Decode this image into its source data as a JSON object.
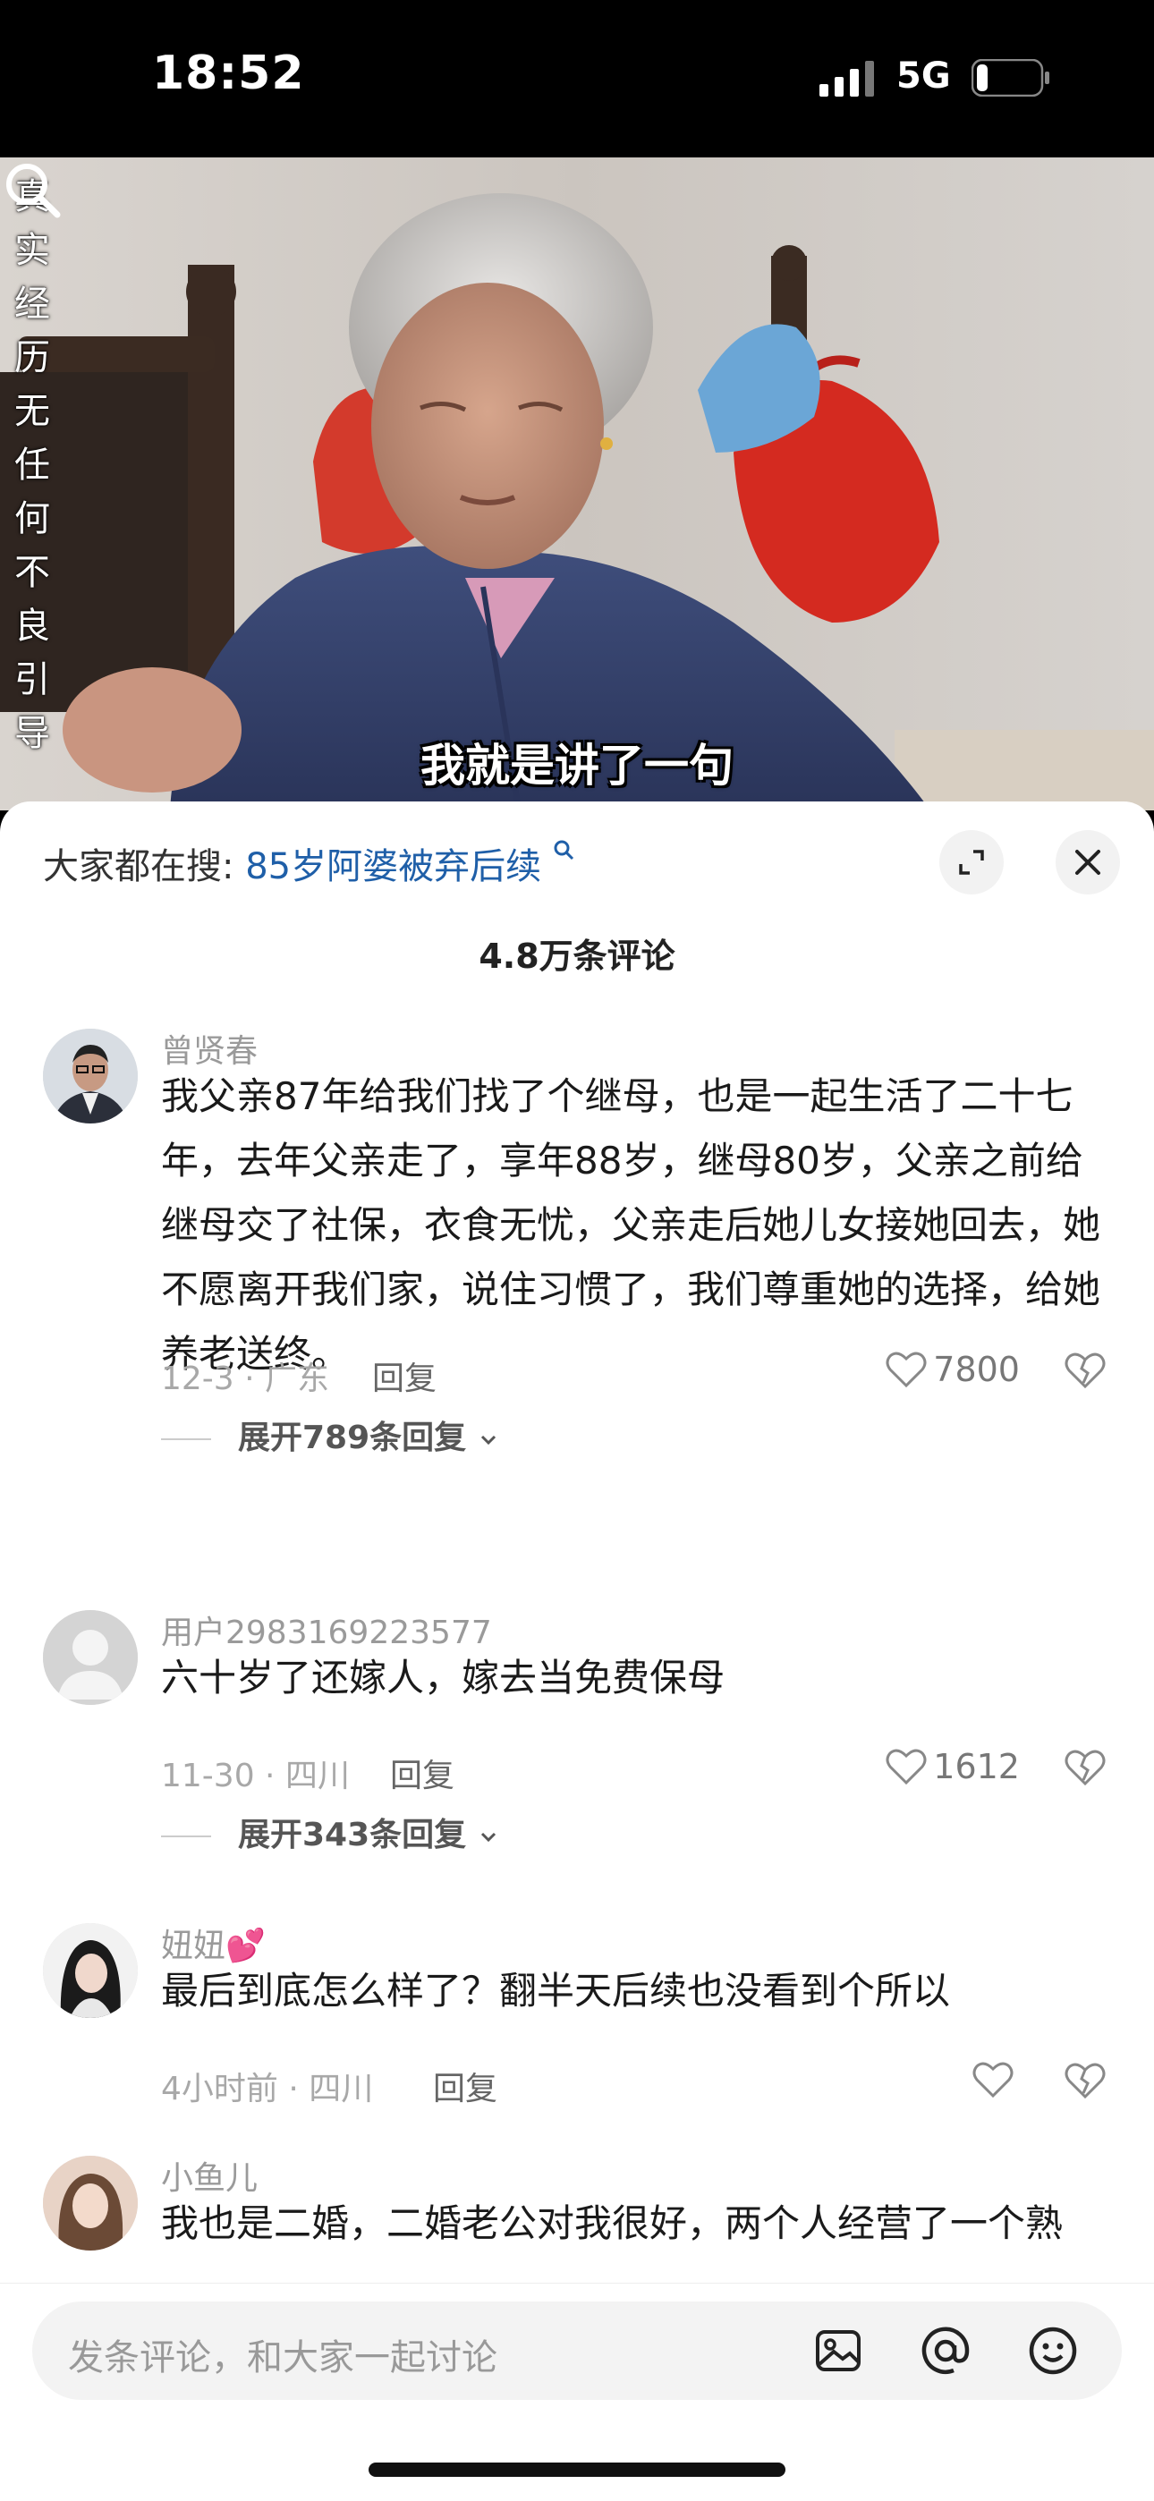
{
  "status": {
    "time": "18:52",
    "network": "5G"
  },
  "video": {
    "vertical_caption": [
      "真",
      "实",
      "经",
      "历",
      "无",
      "任",
      "何",
      "不",
      "良",
      "引",
      "导"
    ],
    "subtitle": "我就是讲了一句"
  },
  "comments_panel": {
    "search_prefix": "大家都在搜:",
    "search_term": "85岁阿婆被弃后续",
    "count_label": "4.8万条评论"
  },
  "comments": [
    {
      "username": "曾贤春",
      "text": "我父亲87年给我们找了个继母，也是一起生活了二十七年，去年父亲走了，享年88岁，继母80岁，父亲之前给继母交了社保，衣食无忧，父亲走后她儿女接她回去，她不愿离开我们家，说住习惯了，我们尊重她的选择，给她养老送终。",
      "meta": "12-3 · 广东",
      "reply": "回复",
      "likes": "7800",
      "expand": "展开789条回复"
    },
    {
      "username": "用户2983169223577",
      "text": "六十岁了还嫁人，嫁去当免费保母",
      "meta": "11-30 · 四川",
      "reply": "回复",
      "likes": "1612",
      "expand": "展开343条回复"
    },
    {
      "username": "妞妞💕",
      "text": "最后到底怎么样了？翻半天后续也没看到个所以",
      "meta": "4小时前 · 四川",
      "reply": "回复",
      "likes": ""
    },
    {
      "username": "小鱼儿",
      "text": "我也是二婚，二婚老公对我很好，两个人经营了一个熟"
    }
  ],
  "input": {
    "placeholder": "发条评论，和大家一起讨论"
  },
  "icons": [
    "signal-icon",
    "battery-icon",
    "search-icon",
    "expand-icon",
    "close-icon",
    "heart-icon",
    "heart-break-icon",
    "image-icon",
    "at-icon",
    "emoji-icon"
  ]
}
